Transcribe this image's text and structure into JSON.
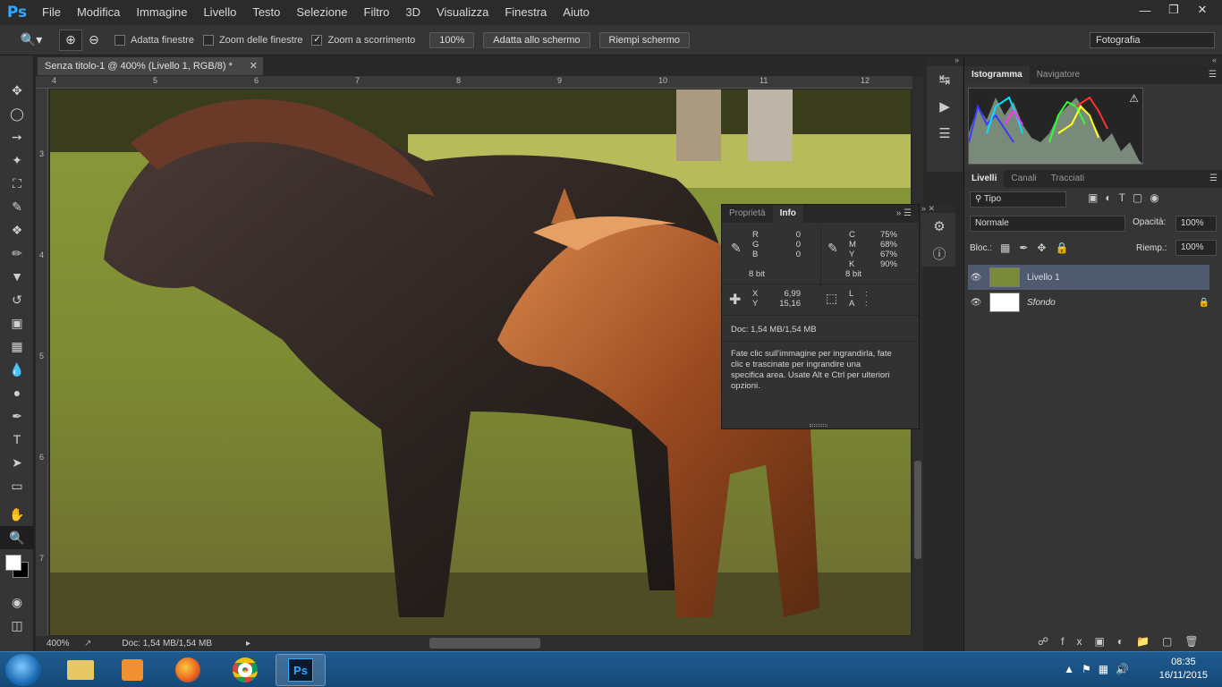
{
  "app": {
    "logo": "Ps",
    "menu": [
      "File",
      "Modifica",
      "Immagine",
      "Livello",
      "Testo",
      "Selezione",
      "Filtro",
      "3D",
      "Visualizza",
      "Finestra",
      "Aiuto"
    ]
  },
  "options": {
    "adatta_finestre": "Adatta finestre",
    "zoom_finestre": "Zoom delle finestre",
    "zoom_scorrimento": "Zoom a scorrimento",
    "zoom_value": "100%",
    "fit_screen": "Adatta allo schermo",
    "fill_screen": "Riempi schermo",
    "workspace": "Fotografia"
  },
  "document": {
    "tab_title": "Senza titolo-1 @ 400% (Livello 1, RGB/8) *",
    "zoom": "400%",
    "doc_size": "Doc: 1,54 MB/1,54 MB",
    "ruler_h": [
      "4",
      "5",
      "6",
      "7",
      "8",
      "9",
      "10",
      "11",
      "12"
    ],
    "ruler_v": [
      "3",
      "4",
      "5",
      "6",
      "7"
    ]
  },
  "info_panel": {
    "tabs": [
      "Proprietà",
      "Info"
    ],
    "rgb": [
      [
        "R",
        "0"
      ],
      [
        "G",
        "0"
      ],
      [
        "B",
        "0"
      ]
    ],
    "cmyk": [
      [
        "C",
        "75%"
      ],
      [
        "M",
        "68%"
      ],
      [
        "Y",
        "67%"
      ],
      [
        "K",
        "90%"
      ]
    ],
    "bits_left": "8 bit",
    "bits_right": "8 bit",
    "xy": [
      [
        "X",
        "6,99"
      ],
      [
        "Y",
        "15,16"
      ]
    ],
    "la": [
      [
        "L",
        ""
      ],
      [
        "A",
        ""
      ]
    ],
    "doc": "Doc: 1,54 MB/1,54 MB",
    "hint": "Fate clic sull'immagine per ingrandirla, fate clic e trascinate per ingrandire una specifica area. Usate Alt e Ctrl per ulteriori opzioni."
  },
  "right": {
    "top_tabs": [
      "Istogramma",
      "Navigatore"
    ],
    "layer_tabs": [
      "Livelli",
      "Canali",
      "Tracciati"
    ],
    "filter_kind": "Tipo",
    "blend_mode": "Normale",
    "opacity_label": "Opacità:",
    "opacity": "100%",
    "lock_label": "Bloc.:",
    "fill_label": "Riemp.:",
    "fill": "100%",
    "layers": [
      {
        "name": "Livello 1",
        "selected": true
      },
      {
        "name": "Sfondo",
        "selected": false
      }
    ]
  },
  "taskbar": {
    "time": "08:35",
    "date": "16/11/2015",
    "apps": [
      "file-explorer",
      "media-player",
      "firefox",
      "chrome",
      "photoshop"
    ]
  }
}
